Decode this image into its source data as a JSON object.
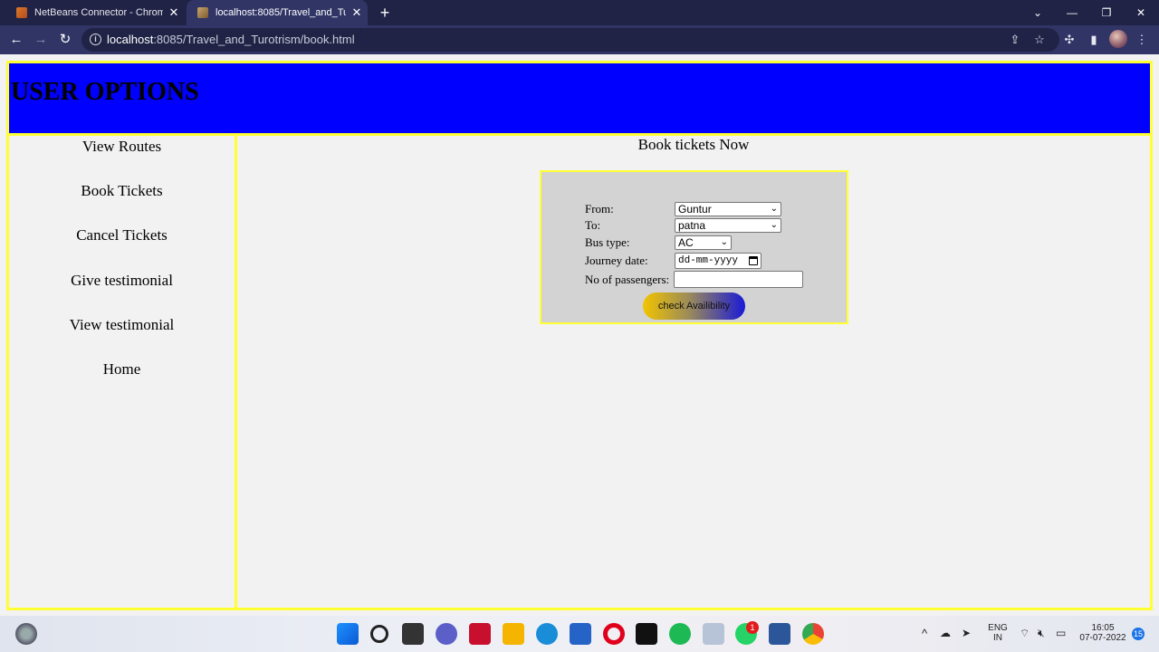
{
  "browser": {
    "tabs": [
      {
        "title": "NetBeans Connector - Chrome W"
      },
      {
        "title": "localhost:8085/Travel_and_Turotri"
      }
    ],
    "url_host": "localhost",
    "url_rest": ":8085/Travel_and_Turotrism/book.html"
  },
  "page": {
    "header_title": "USER OPTIONS",
    "sidebar": [
      {
        "label": "View Routes"
      },
      {
        "label": "Book Tickets"
      },
      {
        "label": "Cancel Tickets"
      },
      {
        "label": "Give testimonial"
      },
      {
        "label": "View testimonial"
      },
      {
        "label": "Home"
      }
    ],
    "content_heading": "Book tickets Now",
    "form": {
      "from_label": "From:",
      "from_value": "Guntur",
      "to_label": "To:",
      "to_value": "patna",
      "bus_type_label": "Bus type:",
      "bus_type_value": "AC",
      "journey_date_label": "Journey date:",
      "journey_date_placeholder": "dd-mm-yyyy",
      "passengers_label": "No of passengers:",
      "passengers_value": "",
      "submit_label": "check Availibility"
    }
  },
  "taskbar": {
    "lang_line1": "ENG",
    "lang_line2": "IN",
    "time": "16:05",
    "date": "07-07-2022",
    "notification_count": "15",
    "whatsapp_badge": "1"
  }
}
